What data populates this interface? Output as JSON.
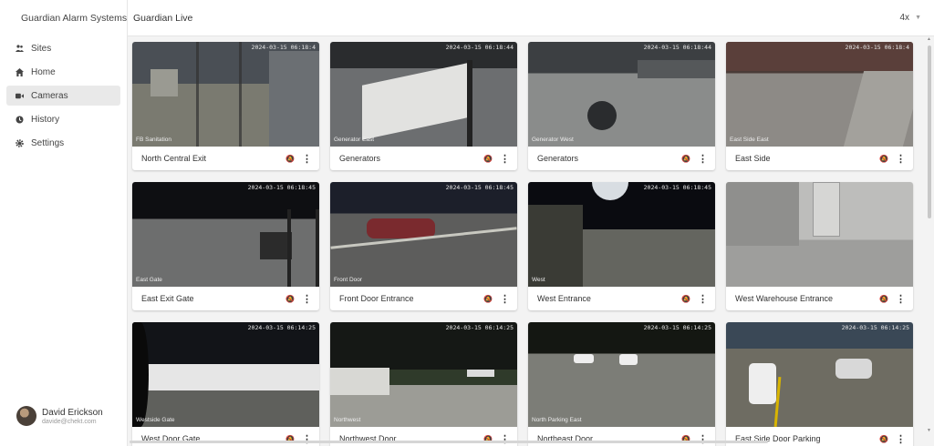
{
  "brand": {
    "name": "Guardian Alarm Systems",
    "logo_icon": "globe-icon"
  },
  "sidebar": {
    "items": [
      {
        "label": "Sites",
        "icon": "people-icon",
        "active": false
      },
      {
        "label": "Home",
        "icon": "home-icon",
        "active": false
      },
      {
        "label": "Cameras",
        "icon": "video-camera-icon",
        "active": true
      },
      {
        "label": "History",
        "icon": "history-icon",
        "active": false
      },
      {
        "label": "Settings",
        "icon": "gear-icon",
        "active": false
      }
    ]
  },
  "user": {
    "name": "David Erickson",
    "email": "davide@chekt.com"
  },
  "header": {
    "title": "Guardian Live",
    "zoom": "4x"
  },
  "cameras": [
    {
      "name": "North Central Exit",
      "timestamp": "2024-03-15 06:18:4",
      "tag": "FB Sanitation"
    },
    {
      "name": "Generators",
      "timestamp": "2024-03-15 06:18:44",
      "tag": "Generator East"
    },
    {
      "name": "Generators",
      "timestamp": "2024-03-15 06:18:44",
      "tag": "Generator West"
    },
    {
      "name": "East Side",
      "timestamp": "2024-03-15 06:18:4",
      "tag": "East Side East"
    },
    {
      "name": "East Exit Gate",
      "timestamp": "2024-03-15 06:18:45",
      "tag": "East Gate"
    },
    {
      "name": "Front Door Entrance",
      "timestamp": "2024-03-15 06:18:45",
      "tag": "Front Door"
    },
    {
      "name": "West Entrance",
      "timestamp": "2024-03-15 06:18:45",
      "tag": "West"
    },
    {
      "name": "West Warehouse Entrance",
      "timestamp": "",
      "tag": ""
    },
    {
      "name": "West Door Gate",
      "timestamp": "2024-03-15 06:14:25",
      "tag": "Westside Gate"
    },
    {
      "name": "Northwest Door",
      "timestamp": "2024-03-15 06:14:25",
      "tag": "Northwest"
    },
    {
      "name": "Northeast Door",
      "timestamp": "2024-03-15 06:14:25",
      "tag": "North Parking East"
    },
    {
      "name": "East Side Door Parking",
      "timestamp": "2024-03-15 06:14:25",
      "tag": ""
    }
  ]
}
